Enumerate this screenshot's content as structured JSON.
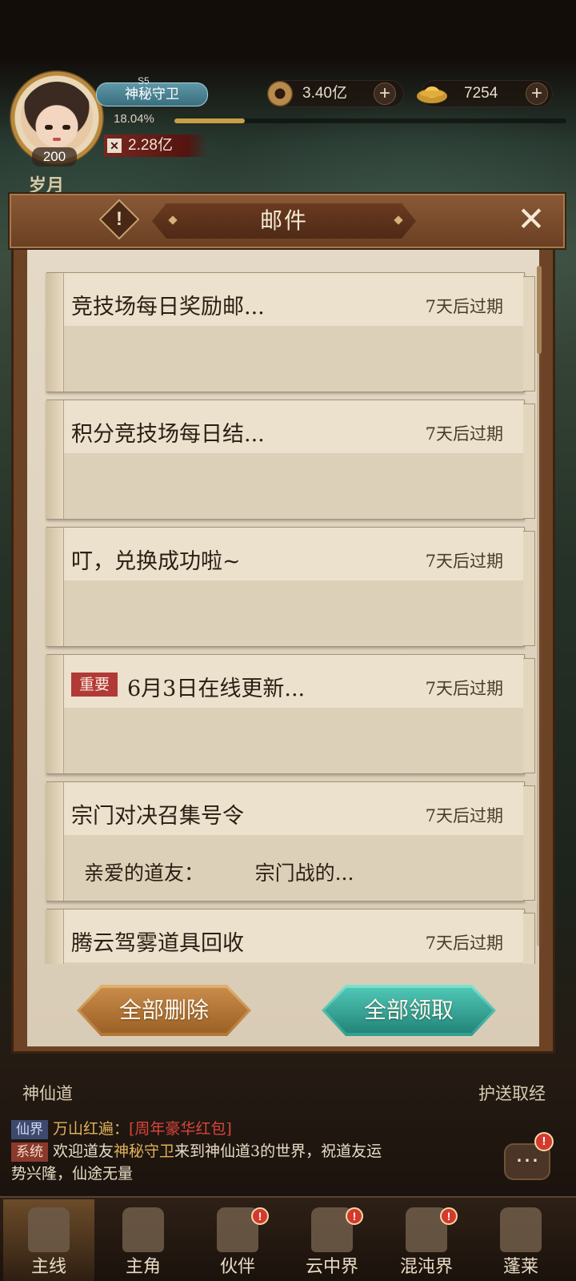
{
  "player": {
    "server": "S5",
    "name": "神秘守卫",
    "exp_percent": "18.04%",
    "power": "2.28亿",
    "level": "200"
  },
  "resources": {
    "coins": "3.40亿",
    "gold": "7254"
  },
  "scene": {
    "year_label": "岁月",
    "bottom_left": "神仙道",
    "bottom_right": "护送取经"
  },
  "mail_panel": {
    "title": "邮件",
    "items": [
      {
        "subject": "竞技场每日奖励邮...",
        "expire": "7天后过期",
        "preview": ""
      },
      {
        "subject": "积分竞技场每日结...",
        "expire": "7天后过期",
        "preview": ""
      },
      {
        "subject": "叮，兑换成功啦~",
        "expire": "7天后过期",
        "preview": ""
      },
      {
        "badge": "重要",
        "subject": "6月3日在线更新...",
        "expire": "7天后过期",
        "preview": ""
      },
      {
        "subject": "宗门对决召集号令",
        "expire": "7天后过期",
        "preview": "亲爱的道友：        宗门战的..."
      },
      {
        "subject": "腾云驾雾道具回收",
        "expire": "7天后过期",
        "preview": ""
      }
    ],
    "delete_all": "全部删除",
    "claim_all": "全部领取"
  },
  "chat": {
    "line1": {
      "channel": "仙界",
      "text": "万山红遍：",
      "link": "[周年豪华红包]"
    },
    "line2": {
      "channel": "系统",
      "pre": "欢迎道友",
      "name": "神秘守卫",
      "post": "来到神仙道3的世界，祝道友运",
      "cont": "势兴隆，仙途无量"
    },
    "alert": "!"
  },
  "nav": [
    {
      "label": "主线",
      "alert": ""
    },
    {
      "label": "主角",
      "alert": ""
    },
    {
      "label": "伙伴",
      "alert": "!"
    },
    {
      "label": "云中界",
      "alert": "!"
    },
    {
      "label": "混沌界",
      "alert": "!"
    },
    {
      "label": "蓬莱",
      "alert": ""
    }
  ],
  "colors": {
    "panel_brown": "#6d4326",
    "parchment": "#e4d9c6",
    "important_badge": "#b13a36",
    "claim_teal": "#4fc6b5",
    "delete_orange": "#c88b4a"
  }
}
